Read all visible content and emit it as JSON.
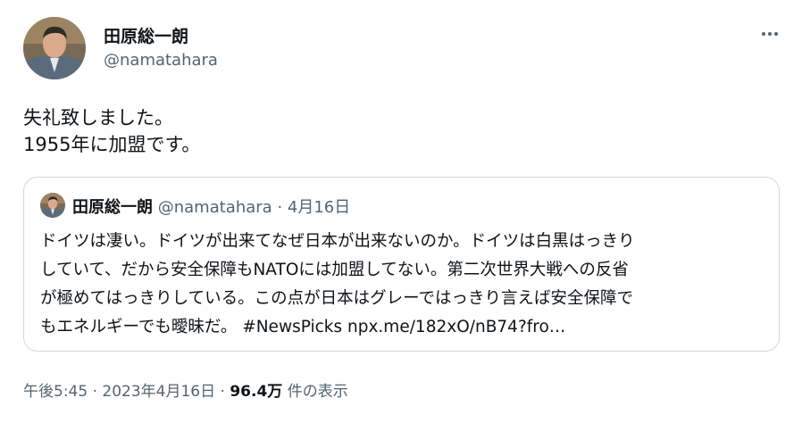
{
  "author": {
    "display_name": "田原総一朗",
    "handle": "@namatahara"
  },
  "tweet": {
    "lines": [
      "失礼致しました。",
      "1955年に加盟です。"
    ]
  },
  "quote": {
    "display_name": "田原総一朗",
    "handle": "@namatahara",
    "separator": "·",
    "date": "4月16日",
    "lines": [
      "ドイツは凄い。ドイツが出来てなぜ日本が出来ないのか。ドイツは白黒はっきり",
      "していて、だから安全保障もNATOには加盟してない。第二次世界大戦への反省",
      "が極めてはっきりしている。この点が日本はグレーではっきり言えば安全保障で",
      "もエネルギーでも曖昧だ。 #NewsPicks npx.me/182xO/nB74?fro…"
    ]
  },
  "meta": {
    "time": "午後5:45",
    "sep1": "·",
    "date": "2023年4月16日",
    "sep2": "·",
    "views_count": "96.4万",
    "views_label": "件の表示"
  },
  "icons": {
    "more": "more-horizontal-icon"
  }
}
